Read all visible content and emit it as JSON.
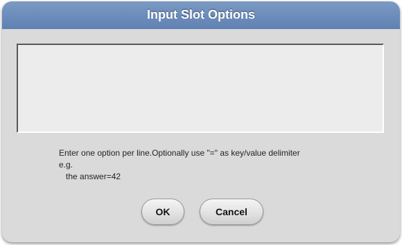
{
  "dialog": {
    "title": "Input Slot Options",
    "options_value": "",
    "help_lines": [
      "Enter one option per line.Optionally use \"=\" as key/value delimiter",
      "e.g.",
      "   the answer=42"
    ],
    "ok_label": "OK",
    "cancel_label": "Cancel"
  }
}
